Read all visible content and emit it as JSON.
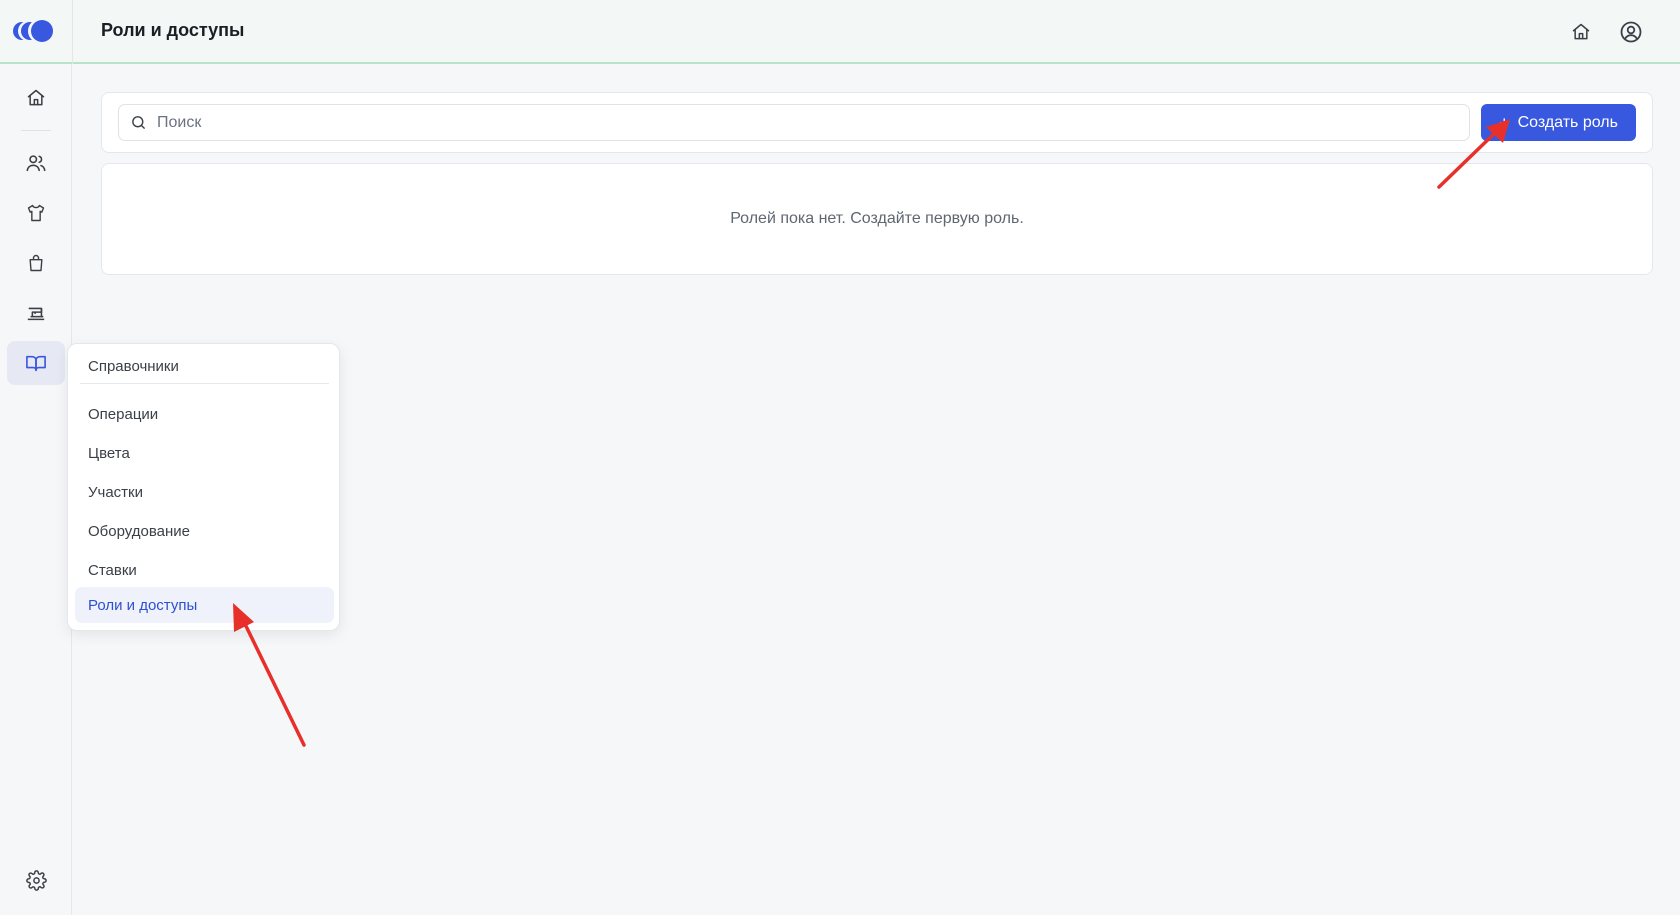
{
  "header": {
    "title": "Роли и доступы"
  },
  "sidebar": {
    "items": [
      {
        "name": "home",
        "icon": "home-icon"
      },
      {
        "name": "users",
        "icon": "users-icon"
      },
      {
        "name": "clothing",
        "icon": "shirt-icon"
      },
      {
        "name": "orders",
        "icon": "shopping-bag-icon"
      },
      {
        "name": "production",
        "icon": "sewing-machine-icon"
      },
      {
        "name": "references",
        "icon": "book-open-icon",
        "active": true
      }
    ],
    "bottom": {
      "name": "settings",
      "icon": "gear-icon"
    }
  },
  "search": {
    "placeholder": "Поиск",
    "value": ""
  },
  "toolbar": {
    "create_label": "Создать роль",
    "create_icon": "+"
  },
  "empty_state": {
    "text": "Ролей пока нет. Создайте первую роль."
  },
  "menu": {
    "header": "Справочники",
    "items": [
      {
        "label": "Операции"
      },
      {
        "label": "Цвета"
      },
      {
        "label": "Участки"
      },
      {
        "label": "Оборудование"
      },
      {
        "label": "Ставки"
      },
      {
        "label": "Роли и доступы",
        "active": true
      }
    ]
  },
  "colors": {
    "accent": "#3858e0",
    "active_bg": "#e6e9f4",
    "topbar_border": "#b9e2cd",
    "annotation": "#e8302a"
  }
}
